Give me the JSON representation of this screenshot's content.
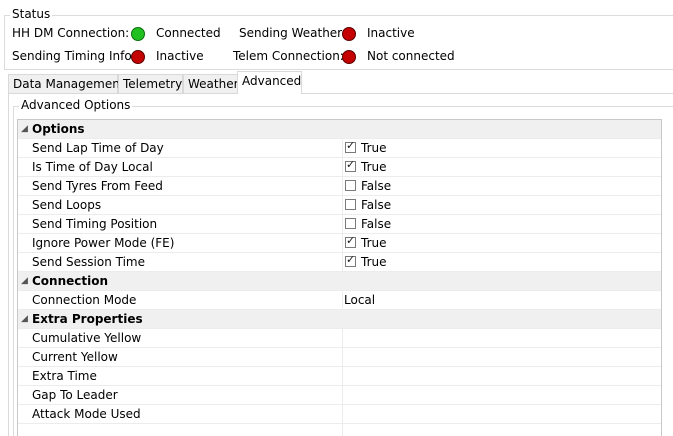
{
  "status": {
    "title": "Status",
    "items": [
      {
        "label": "HH DM Connection:",
        "state": "green",
        "value": "Connected"
      },
      {
        "label": "Sending Weather:",
        "state": "red",
        "value": "Inactive"
      },
      {
        "label": "Sending Timing Info:",
        "state": "red",
        "value": "Inactive"
      },
      {
        "label": "Telem Connection:",
        "state": "red",
        "value": "Not connected"
      }
    ]
  },
  "tabs": [
    {
      "label": "Data Management"
    },
    {
      "label": "Telemetry"
    },
    {
      "label": "Weather"
    },
    {
      "label": "Advanced",
      "active": true
    }
  ],
  "advanced": {
    "title": "Advanced Options",
    "categories": [
      {
        "name": "Options",
        "props": [
          {
            "name": "Send Lap Time of Day",
            "checked": true,
            "value": "True"
          },
          {
            "name": "Is Time of Day Local",
            "checked": true,
            "value": "True"
          },
          {
            "name": "Send Tyres From Feed",
            "checked": false,
            "value": "False"
          },
          {
            "name": "Send Loops",
            "checked": false,
            "value": "False"
          },
          {
            "name": "Send Timing Position",
            "checked": false,
            "value": "False"
          },
          {
            "name": "Ignore Power Mode (FE)",
            "checked": true,
            "value": "True"
          },
          {
            "name": "Send Session Time",
            "checked": true,
            "value": "True"
          }
        ]
      },
      {
        "name": "Connection",
        "props": [
          {
            "name": "Connection Mode",
            "value": "Local"
          }
        ]
      },
      {
        "name": "Extra Properties",
        "props": [
          {
            "name": "Cumulative Yellow",
            "value": ""
          },
          {
            "name": "Current Yellow",
            "value": ""
          },
          {
            "name": "Extra Time",
            "value": ""
          },
          {
            "name": "Gap To Leader",
            "value": ""
          },
          {
            "name": "Attack Mode Used",
            "value": ""
          }
        ]
      }
    ]
  },
  "colors": {
    "connected": "#1fc01f",
    "inactive": "#c40000"
  },
  "icons": {
    "expander": "collapse-triangle-icon",
    "checkbox_tick": "check-icon"
  }
}
